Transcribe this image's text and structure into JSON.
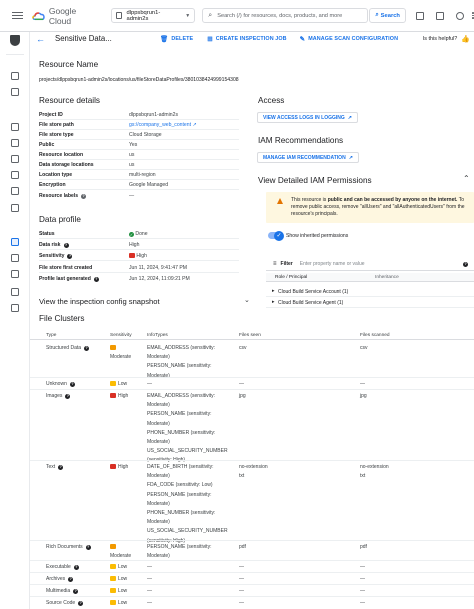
{
  "topbar": {
    "logo_text": "Google Cloud",
    "project": "dlppsbqrun1-admin2s",
    "search_placeholder": "Search (/) for resources, docs, products, and more",
    "search_button": "Search"
  },
  "subheader": {
    "title": "Sensitive Data...",
    "actions": [
      "DELETE",
      "CREATE INSPECTION JOB",
      "MANAGE SCAN CONFIGURATION"
    ],
    "helpful": "Is this helpful?"
  },
  "resource": {
    "name_heading": "Resource Name",
    "name_value": "projects/dlppsbqrun1-admin2s/locations/us/fileStoreDataProfiles/3801038424999154308"
  },
  "details": {
    "heading": "Resource details",
    "rows": [
      {
        "key": "Project ID",
        "value": "dlppsbqrun1-admin2s"
      },
      {
        "key": "File store path",
        "value": "gs://company_web_content"
      },
      {
        "key": "File store type",
        "value": "Cloud Storage"
      },
      {
        "key": "Public",
        "value": "Yes"
      },
      {
        "key": "Resource location",
        "value": "us"
      },
      {
        "key": "Data storage locations",
        "value": "us"
      },
      {
        "key": "Location type",
        "value": "multi-region"
      },
      {
        "key": "Encryption",
        "value": "Google Managed"
      },
      {
        "key": "Resource labels",
        "value": "—"
      }
    ]
  },
  "profile": {
    "heading": "Data profile",
    "rows": [
      {
        "key": "Status",
        "value": "Done"
      },
      {
        "key": "Data risk",
        "value": "High"
      },
      {
        "key": "Sensitivity",
        "value": "High"
      },
      {
        "key": "File store first created",
        "value": "Jun 11, 2024, 9:41:47 PM"
      },
      {
        "key": "Profile last generated",
        "value": "Jun 12, 2024, 11:09:21 PM"
      }
    ],
    "snapshot": "View the inspection config snapshot"
  },
  "access": {
    "heading": "Access",
    "logs_button": "VIEW ACCESS LOGS IN LOGGING",
    "iam_heading": "IAM Recommendations",
    "iam_button": "MANAGE IAM RECOMMENDATION",
    "perm_heading": "View Detailed IAM Permissions",
    "warning_pre": "This resource is ",
    "warning_bold": "public and can be accessed by anyone on the internet.",
    "warning_post": " To remove public access, remove \"allUsers\" and \"allAuthenticatedUsers\" from the resource's principals.",
    "toggle_label": "Show inherited permissions",
    "filter_label": "Filter",
    "filter_placeholder": "Enter property name or value",
    "col_role": "Role / Principal",
    "col_inheritance": "Inheritance",
    "roles": [
      "Cloud Build Service Account (1)",
      "Cloud Build Service Agent (1)"
    ]
  },
  "clusters": {
    "heading": "File Clusters",
    "columns": [
      "Type",
      "Sensitivity",
      "InfoTypes",
      "Files seen",
      "Files scanned"
    ],
    "rows": [
      {
        "type": "Structured Data",
        "sensitivity": "Moderate",
        "infotypes": [
          "EMAIL_ADDRESS (sensitivity:",
          "Moderate)",
          "PERSON_NAME (sensitivity:",
          "Moderate)"
        ],
        "seen": [
          "csv"
        ],
        "scanned": [
          "csv"
        ]
      },
      {
        "type": "Unknown",
        "sensitivity": "Low",
        "infotypes": [
          "—"
        ],
        "seen": [
          "—"
        ],
        "scanned": [
          "—"
        ]
      },
      {
        "type": "Images",
        "sensitivity": "High",
        "infotypes": [
          "EMAIL_ADDRESS (sensitivity:",
          "Moderate)",
          "PERSON_NAME (sensitivity:",
          "Moderate)",
          "PHONE_NUMBER (sensitivity:",
          "Moderate)",
          "US_SOCIAL_SECURITY_NUMBER",
          "(sensitivity: High)"
        ],
        "seen": [
          "jpg"
        ],
        "scanned": [
          "jpg"
        ]
      },
      {
        "type": "Text",
        "sensitivity": "High",
        "infotypes": [
          "DATE_OF_BIRTH (sensitivity:",
          "Moderate)",
          "FDA_CODE (sensitivity: Low)",
          "PERSON_NAME (sensitivity:",
          "Moderate)",
          "PHONE_NUMBER (sensitivity:",
          "Moderate)",
          "US_SOCIAL_SECURITY_NUMBER",
          "(sensitivity: High)"
        ],
        "seen": [
          "no-extension",
          "txt"
        ],
        "scanned": [
          "no-extension",
          "txt"
        ]
      },
      {
        "type": "Rich Documents",
        "sensitivity": "Moderate",
        "infotypes": [
          "PERSON_NAME (sensitivity:",
          "Moderate)"
        ],
        "seen": [
          "pdf"
        ],
        "scanned": [
          "pdf"
        ]
      },
      {
        "type": "Executable",
        "sensitivity": "Low",
        "infotypes": [
          "—"
        ],
        "seen": [
          "—"
        ],
        "scanned": [
          "—"
        ]
      },
      {
        "type": "Archives",
        "sensitivity": "Low",
        "infotypes": [
          "—"
        ],
        "seen": [
          "—"
        ],
        "scanned": [
          "—"
        ]
      },
      {
        "type": "Multimedia",
        "sensitivity": "Low",
        "infotypes": [
          "—"
        ],
        "seen": [
          "—"
        ],
        "scanned": [
          "—"
        ]
      },
      {
        "type": "Source Code",
        "sensitivity": "Low",
        "infotypes": [
          "—"
        ],
        "seen": [
          "—"
        ],
        "scanned": [
          "—"
        ]
      }
    ]
  },
  "colors": {
    "accent": "#1a73e8",
    "high": "#d93025",
    "moderate": "#f29900",
    "low": "#fbbc04",
    "done": "#1e8e3e",
    "warning_bg": "#fef7e0"
  },
  "icons": [
    "menu-icon",
    "google-cloud-logo",
    "search-icon",
    "terminal-icon",
    "notifications-icon",
    "help-icon",
    "more-vert-icon",
    "back-arrow-icon",
    "delete-icon",
    "add-box-icon",
    "edit-icon",
    "thumb-up-icon",
    "warning-icon",
    "check-circle-icon",
    "external-link-icon",
    "filter-icon"
  ]
}
